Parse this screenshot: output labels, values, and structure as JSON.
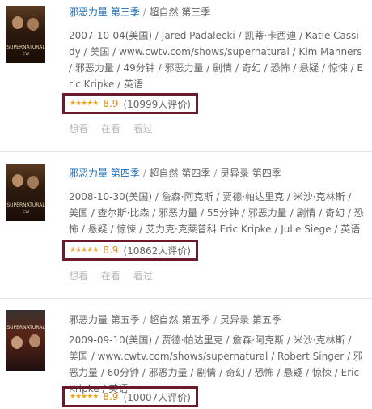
{
  "items": [
    {
      "title_main": "邪恶力量 第三季",
      "separator": "/",
      "title_alt": "超自然 第三季",
      "meta": "2007-10-04(美国) / Jared Padalecki / 凯蒂·卡西迪 / Katie Cassidy / 美国 / www.cwtv.com/shows/supernatural / Kim Manners / 邪恶力量 / 49分钟 / 邪恶力量 / 剧情 / 奇幻 / 恐怖 / 悬疑 / 惊悚 / Eric Kripke / 英语",
      "stars": "★★★★★",
      "score": "8.9",
      "votes": "(10999人评价)",
      "cover_text": "SUPERNATURAL",
      "cover_sub": "CW"
    },
    {
      "title_main": "邪恶力量 第四季",
      "separator": "/",
      "title_alt": "超自然 第四季",
      "title_alt2": "灵异录 第四季",
      "meta": "2008-10-30(美国) / 詹森·阿克斯 / 贾德·帕达里克 / 米沙·克林斯 / 美国 / 查尔斯·比森 / 邪恶力量 / 55分钟 / 邪恶力量 / 剧情 / 奇幻 / 恐怖 / 悬疑 / 惊悚 / 艾力克·克莱普科 Eric Kripke / Julie Siege / 英语",
      "stars": "★★★★★",
      "score": "8.9",
      "votes": "(10862人评价)",
      "cover_text": "SUPERNATURAL",
      "cover_sub": "CW"
    },
    {
      "title_main": "邪恶力量 第五季",
      "separator": "/",
      "title_alt": "超自然 第五季",
      "title_alt2": "灵异录 第五季",
      "meta": "2009-09-10(美国) / 贾德·帕达里克 / 詹森·阿克斯 / 米沙·克林斯 / 美国 / www.cwtv.com/shows/supernatural / Robert Singer / 邪恶力量 / 60分钟 / 邪恶力量 / 剧情 / 奇幻 / 恐怖 / 悬疑 / 惊悚 / Eric Kripke / 英语",
      "stars": "★★★★★",
      "score": "8.9",
      "votes": "(10007人评价)",
      "cover_text": "SUPERNATURAL",
      "cover_sub": ""
    }
  ],
  "actions": {
    "want": "想看",
    "watching": "在看",
    "watched": "看过"
  },
  "colors": {
    "link": "#1f6fb8",
    "highlight_border": "#6a1a28",
    "star": "#f2a21b"
  }
}
